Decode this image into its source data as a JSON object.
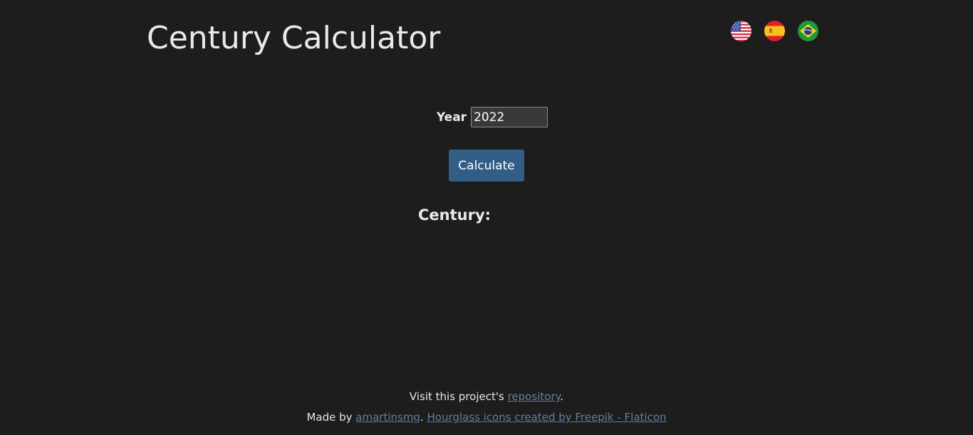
{
  "header": {
    "title": "Century Calculator"
  },
  "languages": [
    {
      "icon": "us-flag-icon",
      "code": "en"
    },
    {
      "icon": "spain-flag-icon",
      "code": "es"
    },
    {
      "icon": "brazil-flag-icon",
      "code": "pt"
    }
  ],
  "form": {
    "year_label": "Year",
    "year_value": "2022",
    "calculate_label": "Calculate"
  },
  "result": {
    "label": "Century:"
  },
  "footer": {
    "visit_prefix": "Visit this project's ",
    "repository_link": "repository",
    "visit_suffix": ".",
    "made_by_prefix": "Made by ",
    "author_link": "amartinsmg",
    "separator": ". ",
    "credits_link": "Hourglass icons created by Freepik - Flaticon"
  },
  "colors": {
    "background": "#1d1d1d",
    "button": "#325d84",
    "link": "#5f7f9f"
  }
}
